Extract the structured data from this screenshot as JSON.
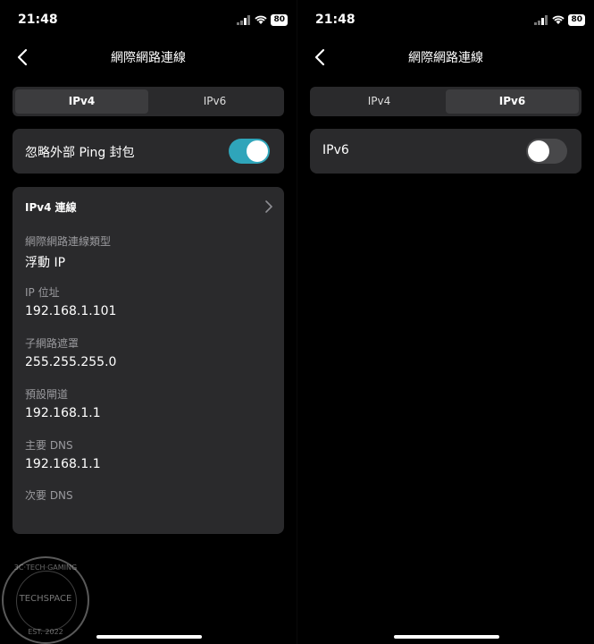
{
  "left": {
    "status": {
      "time": "21:48",
      "battery": "80"
    },
    "nav": {
      "title": "網際網路連線"
    },
    "tabs": [
      {
        "label": "IPv4"
      },
      {
        "label": "IPv6"
      }
    ],
    "active_tab": "IPv4",
    "toggle": {
      "label": "忽略外部 Ping 封包",
      "state": "on"
    },
    "card": {
      "heading": "IPv4 連線",
      "fields": [
        {
          "label": "網際網路連線類型",
          "value": "浮動 IP"
        },
        {
          "label": "IP 位址",
          "value": "192.168.1.101"
        },
        {
          "label": "子網路遮罩",
          "value": "255.255.255.0"
        },
        {
          "label": "預設閘道",
          "value": "192.168.1.1"
        },
        {
          "label": "主要 DNS",
          "value": "192.168.1.1"
        },
        {
          "label": "次要 DNS",
          "value": ""
        }
      ]
    }
  },
  "right": {
    "status": {
      "time": "21:48",
      "battery": "80"
    },
    "nav": {
      "title": "網際網路連線"
    },
    "tabs": [
      {
        "label": "IPv4"
      },
      {
        "label": "IPv6"
      }
    ],
    "active_tab": "IPv6",
    "toggle": {
      "label": "IPv6",
      "state": "off"
    }
  },
  "watermark": {
    "top": "3C·TECH·GAMING",
    "center": "TECHSPACE",
    "bottom": "EST. 2022"
  },
  "colors": {
    "accent": "#2fa5ba",
    "card": "#2a2a2c",
    "background": "#000000"
  }
}
